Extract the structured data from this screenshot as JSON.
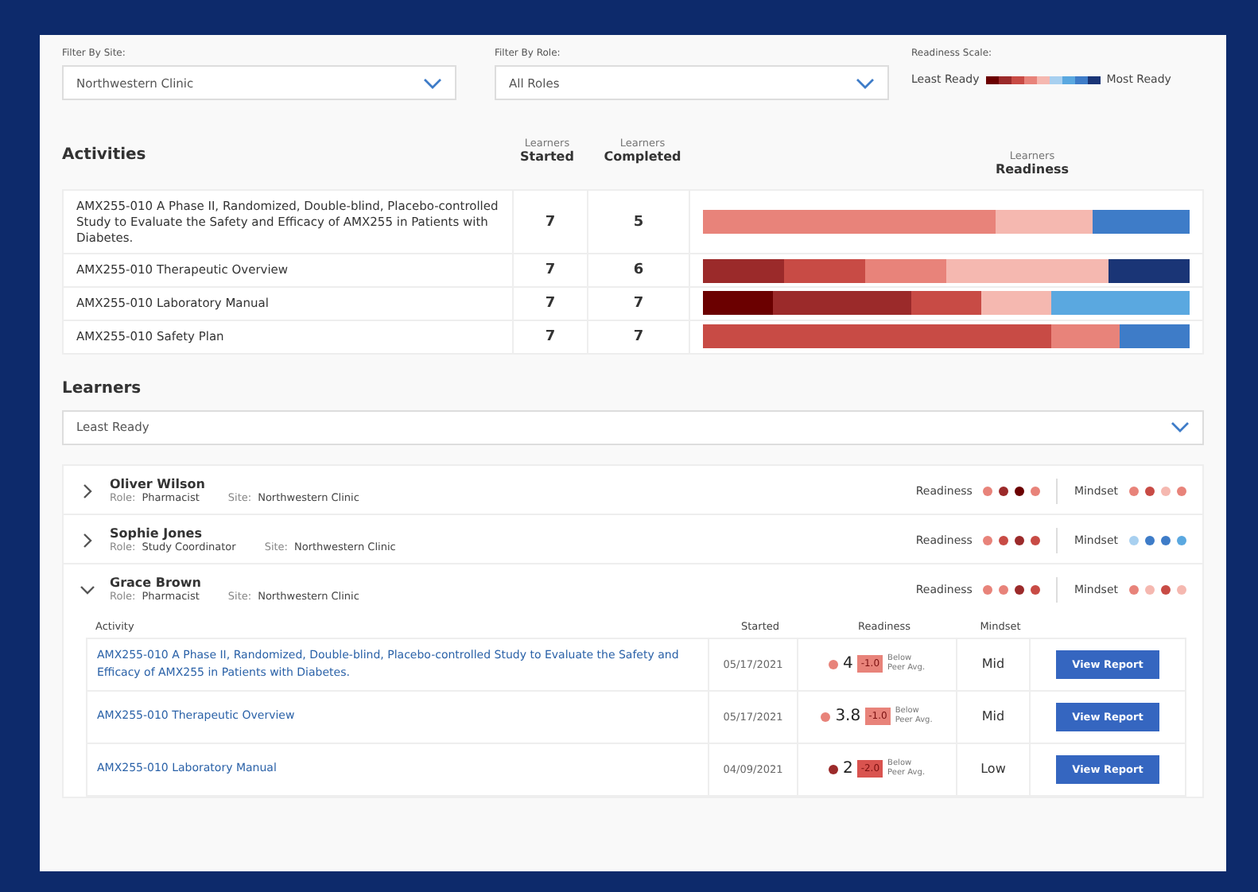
{
  "filters": [
    {
      "label": "Filter By Site:",
      "value": "Northwestern Clinic"
    },
    {
      "label": "Filter By Role:",
      "value": "All Roles"
    }
  ],
  "scale": {
    "label": "Readiness Scale:",
    "low": "Least Ready",
    "high": "Most Ready"
  },
  "activities": {
    "title": "Activities",
    "columns": [
      {
        "top": "Learners",
        "bottom": "Started"
      },
      {
        "top": "Learners",
        "bottom": "Completed"
      },
      {
        "top": "Learners",
        "bottom": "Readiness"
      }
    ],
    "rows": [
      {
        "name": "AMX255-010 A Phase II, Randomized, Double-blind, Placebo-controlled Study to Evaluate the Safety and Efficacy of AMX255 in Patients with Diabetes.",
        "started": "7",
        "completed": "5",
        "segments": [
          {
            "color": "#e8837a"
          },
          {
            "color": "#e8837a"
          },
          {
            "color": "#e8837a"
          },
          {
            "color": "#f5b8b0"
          },
          {
            "color": "#3e7cc8"
          }
        ]
      },
      {
        "name": "AMX255-010 Therapeutic Overview",
        "started": "7",
        "completed": "6",
        "segments": [
          {
            "color": "#9b2a2a"
          },
          {
            "color": "#c84b45"
          },
          {
            "color": "#e8837a"
          },
          {
            "color": "#f5b8b0"
          },
          {
            "color": "#f5b8b0"
          },
          {
            "color": "#1a3576"
          }
        ]
      },
      {
        "name": "AMX255-010 Laboratory Manual",
        "started": "7",
        "completed": "7",
        "segments": [
          {
            "color": "#6b0000"
          },
          {
            "color": "#9b2a2a"
          },
          {
            "color": "#9b2a2a"
          },
          {
            "color": "#c84b45"
          },
          {
            "color": "#f5b8b0"
          },
          {
            "color": "#5aa8e0"
          },
          {
            "color": "#5aa8e0"
          }
        ]
      },
      {
        "name": "AMX255-010 Safety Plan",
        "started": "7",
        "completed": "7",
        "segments": [
          {
            "color": "#c84b45"
          },
          {
            "color": "#c84b45"
          },
          {
            "color": "#c84b45"
          },
          {
            "color": "#c84b45"
          },
          {
            "color": "#c84b45"
          },
          {
            "color": "#e8837a"
          },
          {
            "color": "#3e7cc8"
          }
        ]
      }
    ]
  },
  "learners": {
    "title": "Learners",
    "sort": "Least Ready",
    "columns": [
      "Activity",
      "Started",
      "Readiness",
      "Mindset"
    ],
    "items": [
      {
        "name": "Oliver Wilson",
        "role_label": "Role:",
        "site_label": "Site:",
        "readiness_label": "Readiness",
        "mindset_label": "Mindset",
        "role": "Pharmacist",
        "site": "Northwestern Clinic",
        "expanded": false,
        "readiness": [
          {
            "color": "#e8837a"
          },
          {
            "color": "#9b2a2a"
          },
          {
            "color": "#6b0000"
          },
          {
            "color": "#e8837a"
          }
        ],
        "mindset": [
          {
            "color": "#e8837a"
          },
          {
            "color": "#c84b45"
          },
          {
            "color": "#f5b8b0"
          },
          {
            "color": "#e8837a"
          }
        ]
      },
      {
        "name": "Sophie Jones",
        "role_label": "Role:",
        "site_label": "Site:",
        "readiness_label": "Readiness",
        "mindset_label": "Mindset",
        "role": "Study Coordinator",
        "site": "Northwestern Clinic",
        "expanded": false,
        "readiness": [
          {
            "color": "#e8837a"
          },
          {
            "color": "#c84b45"
          },
          {
            "color": "#9b2a2a"
          },
          {
            "color": "#c84b45"
          }
        ],
        "mindset": [
          {
            "color": "#a8d0f0"
          },
          {
            "color": "#3e7cc8"
          },
          {
            "color": "#3e7cc8"
          },
          {
            "color": "#5aa8e0"
          }
        ]
      },
      {
        "name": "Grace Brown",
        "role_label": "Role:",
        "site_label": "Site:",
        "readiness_label": "Readiness",
        "mindset_label": "Mindset",
        "role": "Pharmacist",
        "site": "Northwestern Clinic",
        "expanded": true,
        "readiness": [
          {
            "color": "#e8837a"
          },
          {
            "color": "#e8837a"
          },
          {
            "color": "#9b2a2a"
          },
          {
            "color": "#c84b45"
          }
        ],
        "mindset": [
          {
            "color": "#e8837a"
          },
          {
            "color": "#f5b8b0"
          },
          {
            "color": "#c84b45"
          },
          {
            "color": "#f5b8b0"
          }
        ],
        "activities": [
          {
            "name": "AMX255-010 A Phase II, Randomized, Double-blind, Placebo-controlled Study to Evaluate the Safety and Efficacy of AMX255 in Patients with Diabetes.",
            "started": "05/17/2021",
            "color": "#e8837a",
            "score": "4",
            "delta": {
              "text": "-1.0",
              "color": "#e8837a"
            },
            "note": "Below Peer Avg.",
            "mindset": "Mid",
            "button": "View Report"
          },
          {
            "name": "AMX255-010 Therapeutic Overview",
            "started": "05/17/2021",
            "color": "#e8837a",
            "score": "3.8",
            "delta": {
              "text": "-1.0",
              "color": "#e8837a"
            },
            "note": "Below Peer Avg.",
            "mindset": "Mid",
            "button": "View Report"
          },
          {
            "name": "AMX255-010 Laboratory Manual",
            "started": "04/09/2021",
            "color": "#9b2a2a",
            "score": "2",
            "delta": {
              "text": "-2.0",
              "color": "#d9534f"
            },
            "note": "Below Peer Avg.",
            "mindset": "Low",
            "button": "View Report"
          }
        ]
      }
    ]
  }
}
